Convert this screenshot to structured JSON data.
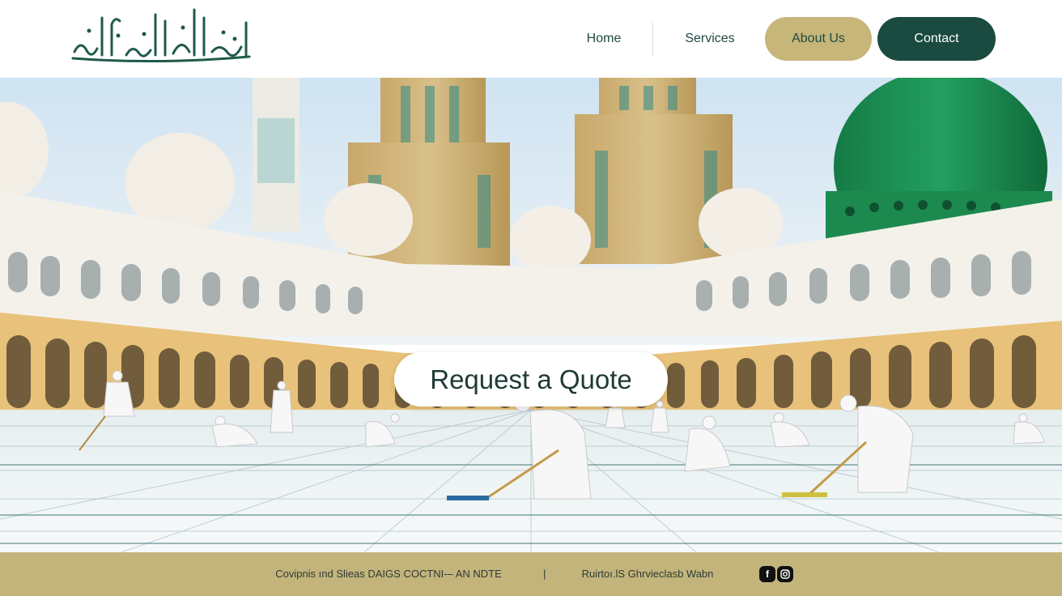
{
  "header": {
    "logo_text": "الحرم النبوي",
    "nav": {
      "home": "Home",
      "services": "Services",
      "about": "About Us",
      "contact": "Contact"
    }
  },
  "hero": {
    "cta_label": "Request a Quote"
  },
  "footer": {
    "left_text": "Covipnis ınd Slieas DAIGS COCTNI-– AN NDTE",
    "separator": "|",
    "right_text": "Ruirtoı.lS Ghrvieclasb Wabn",
    "social": [
      "facebook-icon",
      "instagram-icon"
    ]
  },
  "colors": {
    "brand_dark": "#1a4a40",
    "brand_gold": "#c6b67a",
    "footer_bg": "#c3b47c",
    "dome_green": "#1d8a52"
  }
}
